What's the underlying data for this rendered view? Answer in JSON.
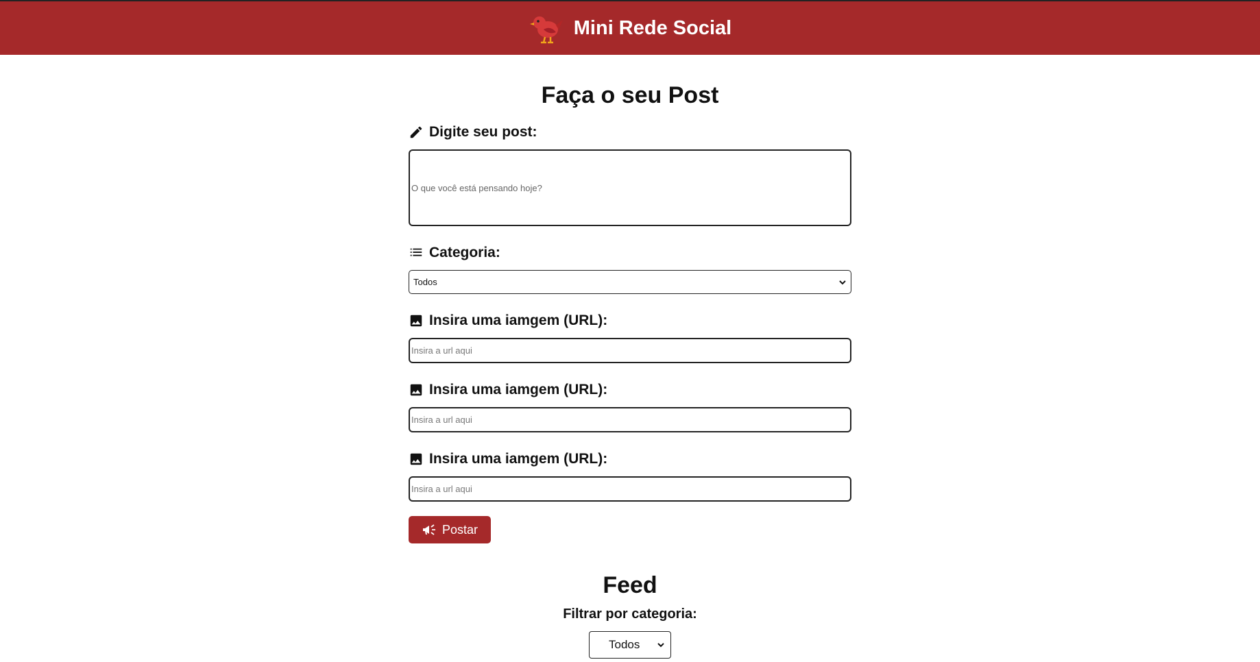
{
  "header": {
    "title": "Mini Rede Social",
    "logo_icon": "red-bird-icon",
    "background": "#a5292a"
  },
  "post_form": {
    "title": "Faça o seu Post",
    "post_label": "Digite seu post:",
    "post_placeholder": "O que você está pensando hoje?",
    "category_label": "Categoria:",
    "category_selected": "Todos",
    "image_fields": [
      {
        "label": "Insira uma iamgem (URL):",
        "placeholder": "Insira a url aqui"
      },
      {
        "label": "Insira uma iamgem (URL):",
        "placeholder": "Insira a url aqui"
      },
      {
        "label": "Insira uma iamgem (URL):",
        "placeholder": "Insira a url aqui"
      }
    ],
    "submit_label": "Postar"
  },
  "feed": {
    "title": "Feed",
    "filter_label": "Filtrar por categoria:",
    "filter_selected": "Todos"
  }
}
